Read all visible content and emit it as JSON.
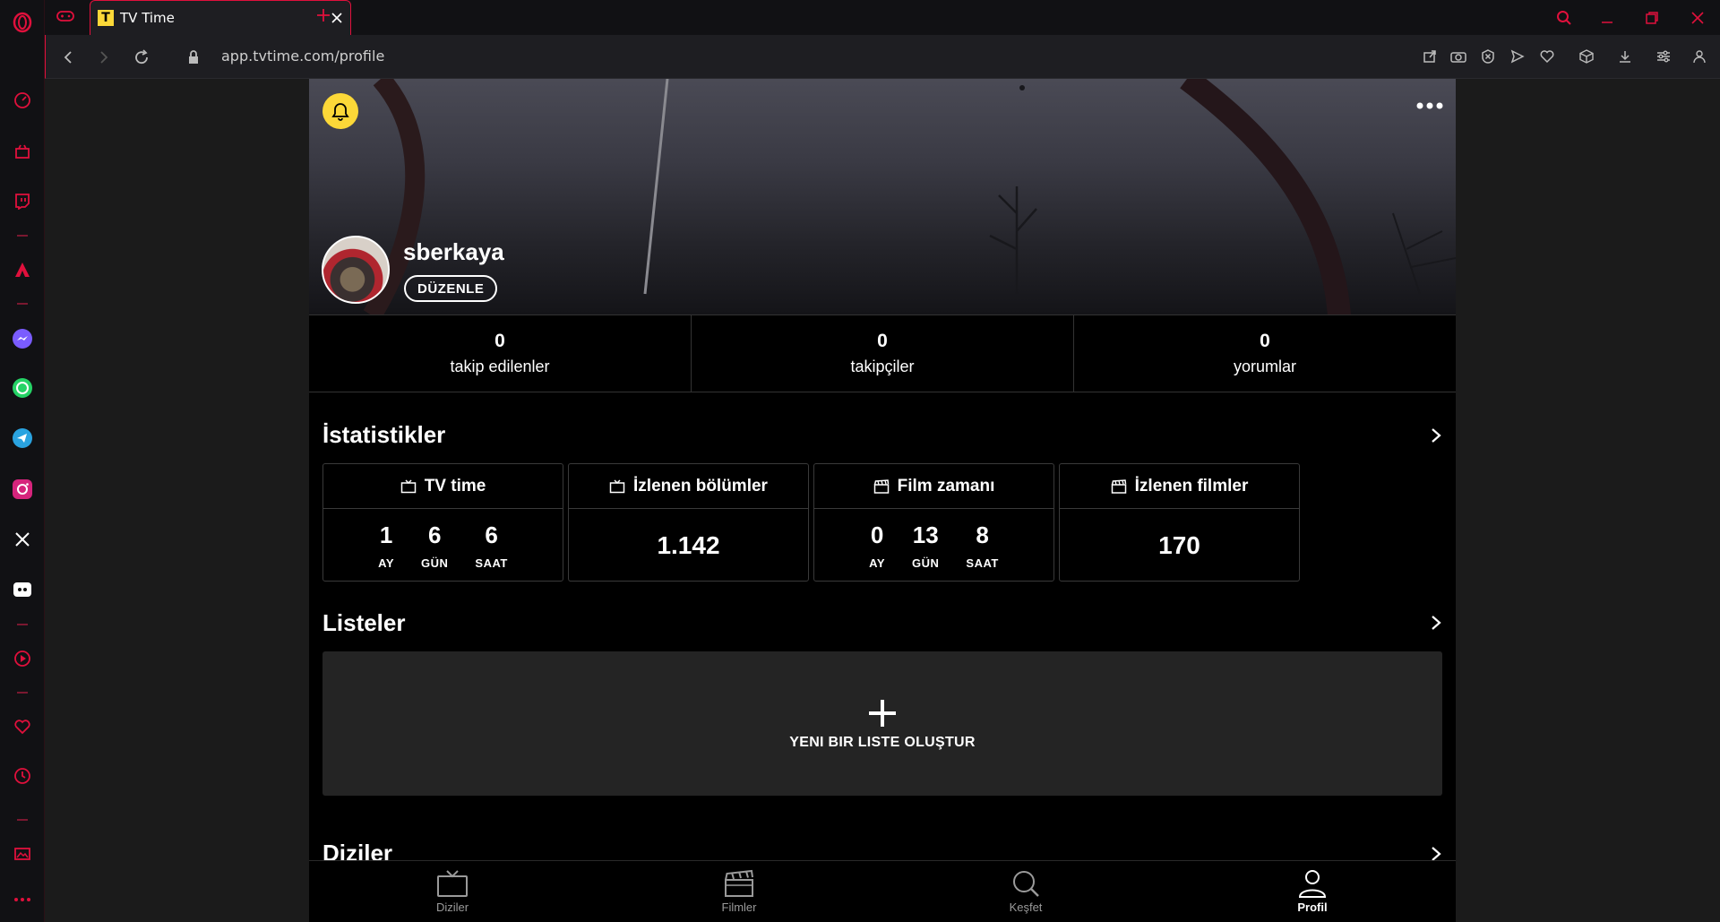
{
  "browser": {
    "tab_title": "TV Time",
    "tab_favicon": "T",
    "url": "app.tvtime.com/profile",
    "accent_color": "#e0103c"
  },
  "sidebar": {
    "icons": [
      "opera-logo-icon",
      "speed-dial-icon",
      "shop-icon",
      "twitch-icon",
      "aria-icon",
      "messenger-icon",
      "whatsapp-icon",
      "telegram-icon",
      "instagram-icon",
      "x-icon",
      "discord-icon",
      "player-icon",
      "heart-icon",
      "history-icon",
      "gallery-icon",
      "more-icon"
    ]
  },
  "profile": {
    "username": "sberkaya",
    "edit_label": "DÜZENLE",
    "brand_color": "#fcd838",
    "counts": [
      {
        "value": "0",
        "label": "takip edilenler"
      },
      {
        "value": "0",
        "label": "takipçiler"
      },
      {
        "value": "0",
        "label": "yorumlar"
      }
    ]
  },
  "stats": {
    "title": "İstatistikler",
    "tv_time": {
      "label": "TV time",
      "units": [
        {
          "num": "1",
          "lbl": "AY"
        },
        {
          "num": "6",
          "lbl": "GÜN"
        },
        {
          "num": "6",
          "lbl": "SAAT"
        }
      ]
    },
    "episodes": {
      "label": "İzlenen bölümler",
      "value": "1.142"
    },
    "film_time": {
      "label": "Film zamanı",
      "units": [
        {
          "num": "0",
          "lbl": "AY"
        },
        {
          "num": "13",
          "lbl": "GÜN"
        },
        {
          "num": "8",
          "lbl": "SAAT"
        }
      ]
    },
    "films": {
      "label": "İzlenen filmler",
      "value": "170"
    }
  },
  "lists": {
    "title": "Listeler",
    "new_list_label": "YENI BIR LISTE OLUŞTUR"
  },
  "shows": {
    "title": "Diziler"
  },
  "bottom_nav": [
    {
      "label": "Diziler",
      "icon": "tv-icon"
    },
    {
      "label": "Filmler",
      "icon": "clapperboard-icon"
    },
    {
      "label": "Keşfet",
      "icon": "search-icon"
    },
    {
      "label": "Profil",
      "icon": "user-icon",
      "active": true
    }
  ]
}
